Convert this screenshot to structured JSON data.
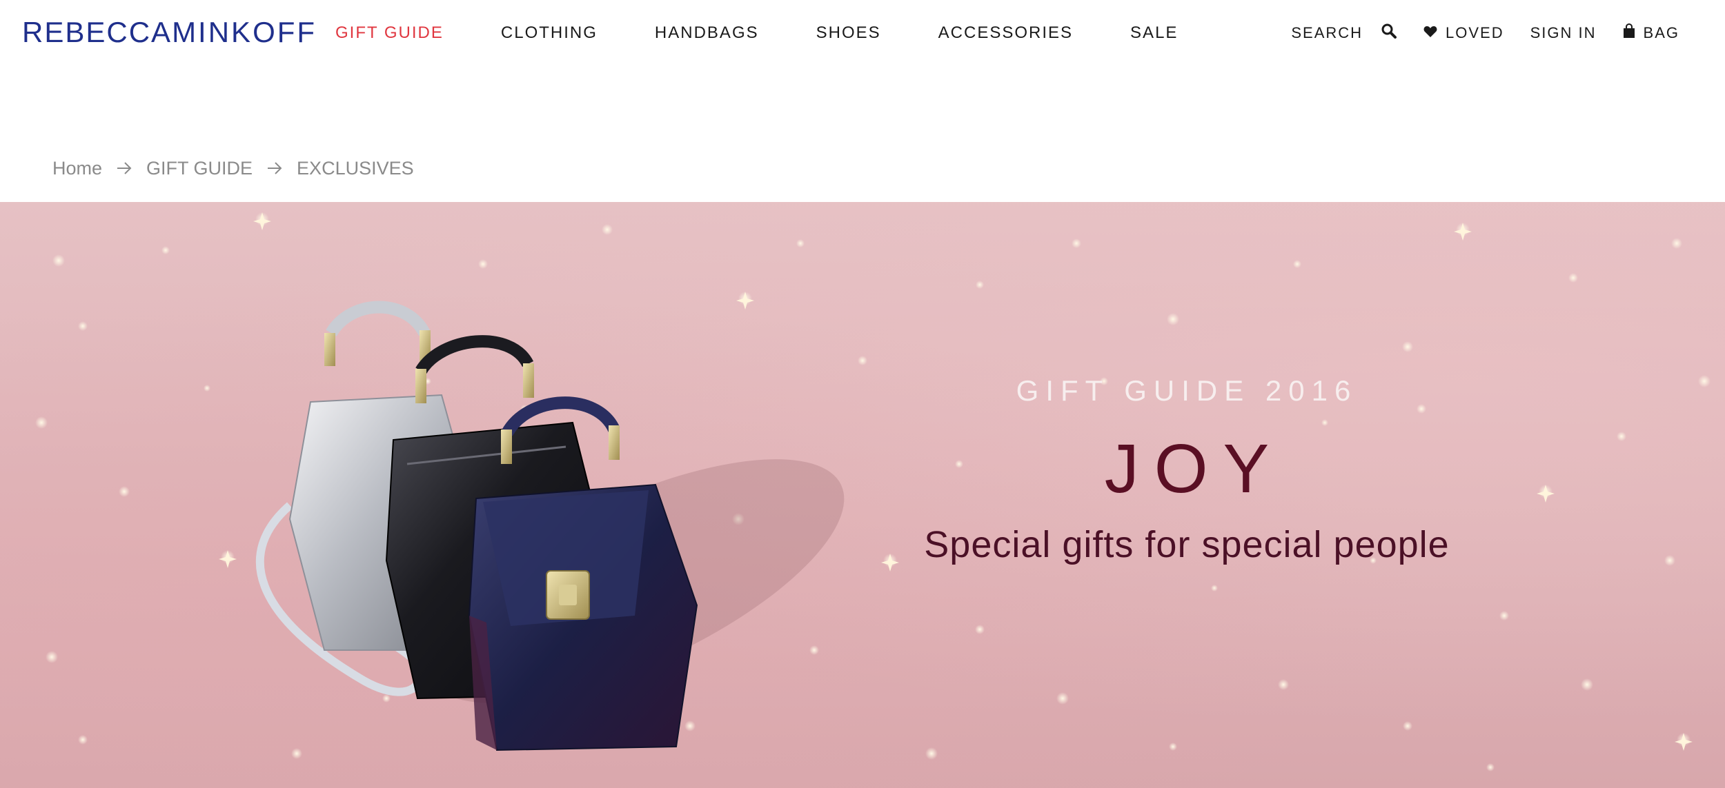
{
  "header": {
    "logo": {
      "part1": "REBECCA",
      "part2": "MINKOFF"
    },
    "nav": [
      {
        "label": "GIFT GUIDE",
        "active": true
      },
      {
        "label": "CLOTHING",
        "active": false
      },
      {
        "label": "HANDBAGS",
        "active": false
      },
      {
        "label": "SHOES",
        "active": false
      },
      {
        "label": "ACCESSORIES",
        "active": false
      },
      {
        "label": "SALE",
        "active": false
      }
    ],
    "utility": {
      "search_label": "SEARCH",
      "search_icon": "search-icon",
      "loved_label": "LOVED",
      "loved_icon": "heart-icon",
      "signin_label": "SIGN IN",
      "bag_label": "BAG",
      "bag_icon": "shopping-bag-icon"
    }
  },
  "breadcrumb": {
    "items": [
      "Home",
      "GIFT GUIDE",
      "EXCLUSIVES"
    ],
    "separator_icon": "arrow-right-icon"
  },
  "hero": {
    "eyebrow": "GIFT GUIDE 2016",
    "title": "JOY",
    "subtitle": "Special gifts for special people"
  },
  "colors": {
    "brand": "#1f2f8c",
    "nav_active": "#e0363f",
    "hero_bg": "#dfb3b7",
    "hero_title": "#5a0f24"
  }
}
